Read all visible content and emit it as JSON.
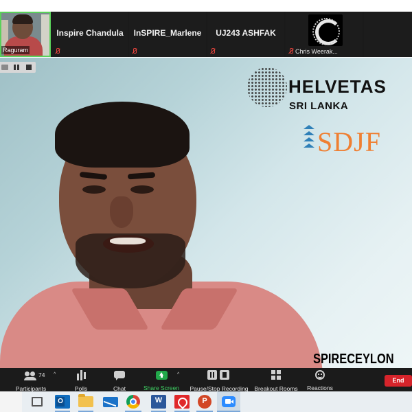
{
  "participants_strip": {
    "self_name": "Raguram",
    "tiles": [
      {
        "name": "Inspire Chandula",
        "muted": true
      },
      {
        "name": "InSPIRE_Marlene",
        "muted": true
      },
      {
        "name": "UJ243 ASHFAK",
        "muted": true
      }
    ],
    "chris_name": "Chris Weerak..."
  },
  "main_video": {
    "logo_title": "HELVETAS",
    "logo_subtitle": "SRI LANKA",
    "sdjf": "SDJF",
    "background_text": "SPIRECEYLON"
  },
  "toolbar": {
    "participants_label": "Participants",
    "participant_count": "74",
    "polls_label": "Polls",
    "chat_label": "Chat",
    "share_label": "Share Screen",
    "record_label": "Pause/Stop Recording",
    "breakout_label": "Breakout Rooms",
    "reactions_label": "Reactions",
    "end_label": "End"
  },
  "colors": {
    "share_accent": "#22a84a",
    "end_button": "#d6242b",
    "muted_icon": "#e0423c",
    "next_page_button": "#1d7cf2",
    "sdjf_orange": "#ef7f32",
    "sdjf_blue": "#2f80b8"
  },
  "taskbar_icons": [
    "start-icon",
    "task-view-icon",
    "outlook-icon",
    "file-explorer-icon",
    "mail-icon",
    "chrome-icon",
    "word-icon",
    "acrobat-icon",
    "powerpoint-icon",
    "zoom-icon"
  ]
}
